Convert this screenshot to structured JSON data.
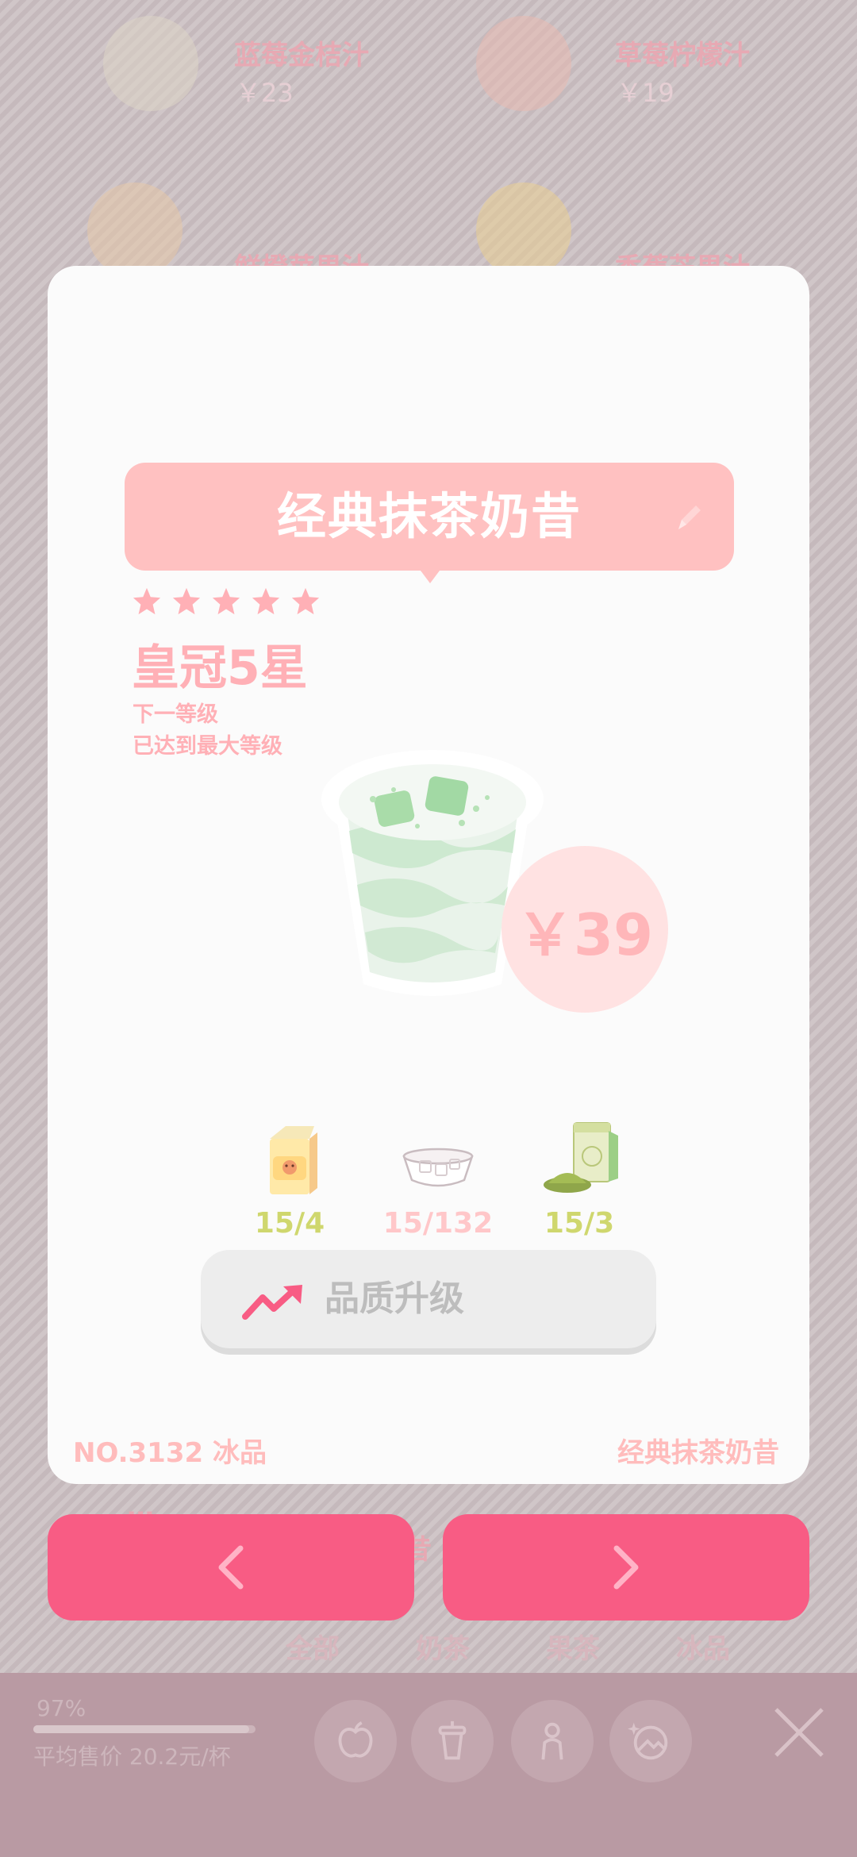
{
  "background_menu": {
    "items": [
      {
        "name": "蓝莓金桔汁",
        "price": "￥23"
      },
      {
        "name": "草莓柠檬汁",
        "price": "￥19"
      },
      {
        "name": "鲜橙苹果汁",
        "price": ""
      },
      {
        "name": "香蕉芒果汁",
        "price": ""
      },
      {
        "name": "…",
        "price": ""
      },
      {
        "name": "昔",
        "price": ""
      }
    ],
    "tabs": [
      "全部",
      "奶茶",
      "果茶",
      "冰品"
    ]
  },
  "bottom_bar": {
    "progress_text": "97%",
    "progress_value": 0.97,
    "avg_price": "平均售价 20.2元/杯",
    "icons": [
      "apple-icon",
      "cup-icon",
      "person-icon",
      "photo-sparkle-icon",
      "close-icon"
    ]
  },
  "modal": {
    "title": "经典抹茶奶昔",
    "stars": 5,
    "rank": "皇冠5星",
    "next_level_label": "下一等级",
    "next_level_value": "已达到最大等级",
    "price": "￥39",
    "ingredients": [
      {
        "icon": "milk-carton-icon",
        "count": "15/4",
        "color": "#cfd76e"
      },
      {
        "icon": "ice-bowl-icon",
        "count": "15/132",
        "color": "#ffc7c9"
      },
      {
        "icon": "matcha-powder-icon",
        "count": "15/3",
        "color": "#cfd76e"
      }
    ],
    "upgrade_label": "品质升级",
    "footer_left": "NO.3132 冰品",
    "footer_right": "经典抹茶奶昔"
  },
  "navigation": {
    "prev_icon": "chevron-left-icon",
    "next_icon": "chevron-right-icon"
  },
  "colors": {
    "accent_pink": "#f85c84",
    "banner_pink": "#ffc1c1",
    "ingredient_green": "#cfd76e",
    "ingredient_pink": "#ffc7c9"
  }
}
